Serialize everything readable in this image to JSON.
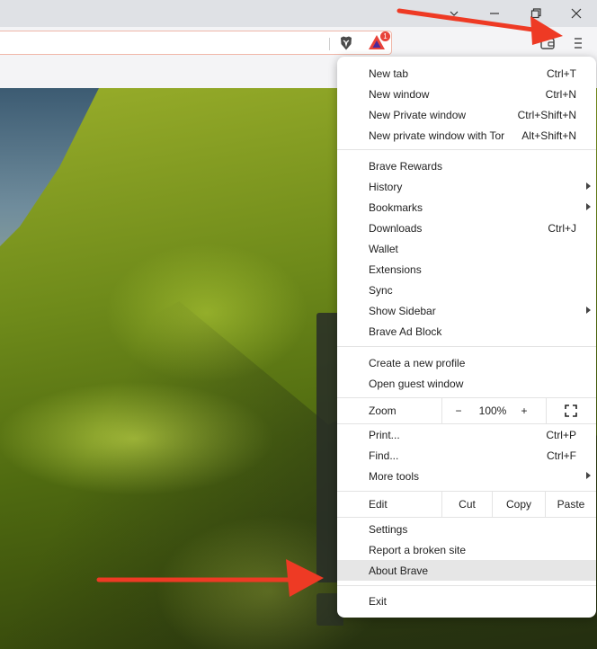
{
  "window": {
    "colors": {
      "accent_arrow": "#ee3a24",
      "brave_orange": "#fb542b"
    }
  },
  "toolbar": {
    "rewards_badge_count": "1"
  },
  "menu": {
    "group1": [
      {
        "label": "New tab",
        "shortcut": "Ctrl+T"
      },
      {
        "label": "New window",
        "shortcut": "Ctrl+N"
      },
      {
        "label": "New Private window",
        "shortcut": "Ctrl+Shift+N"
      },
      {
        "label": "New private window with Tor",
        "shortcut": "Alt+Shift+N"
      }
    ],
    "group2": [
      {
        "label": "Brave Rewards",
        "shortcut": ""
      },
      {
        "label": "History",
        "shortcut": "",
        "submenu": true
      },
      {
        "label": "Bookmarks",
        "shortcut": "",
        "submenu": true
      },
      {
        "label": "Downloads",
        "shortcut": "Ctrl+J"
      },
      {
        "label": "Wallet",
        "shortcut": ""
      },
      {
        "label": "Extensions",
        "shortcut": ""
      },
      {
        "label": "Sync",
        "shortcut": ""
      },
      {
        "label": "Show Sidebar",
        "shortcut": "",
        "submenu": true
      },
      {
        "label": "Brave Ad Block",
        "shortcut": ""
      }
    ],
    "group3": [
      {
        "label": "Create a new profile"
      },
      {
        "label": "Open guest window"
      }
    ],
    "zoom": {
      "label": "Zoom",
      "minus": "−",
      "value": "100%",
      "plus": "+"
    },
    "group4": [
      {
        "label": "Print...",
        "shortcut": "Ctrl+P"
      },
      {
        "label": "Find...",
        "shortcut": "Ctrl+F"
      },
      {
        "label": "More tools",
        "shortcut": "",
        "submenu": true
      }
    ],
    "edit": {
      "label": "Edit",
      "cut": "Cut",
      "copy": "Copy",
      "paste": "Paste"
    },
    "group5": [
      {
        "label": "Settings"
      },
      {
        "label": "Report a broken site"
      },
      {
        "label": "About Brave",
        "highlighted": true
      }
    ],
    "exit": {
      "label": "Exit"
    }
  }
}
